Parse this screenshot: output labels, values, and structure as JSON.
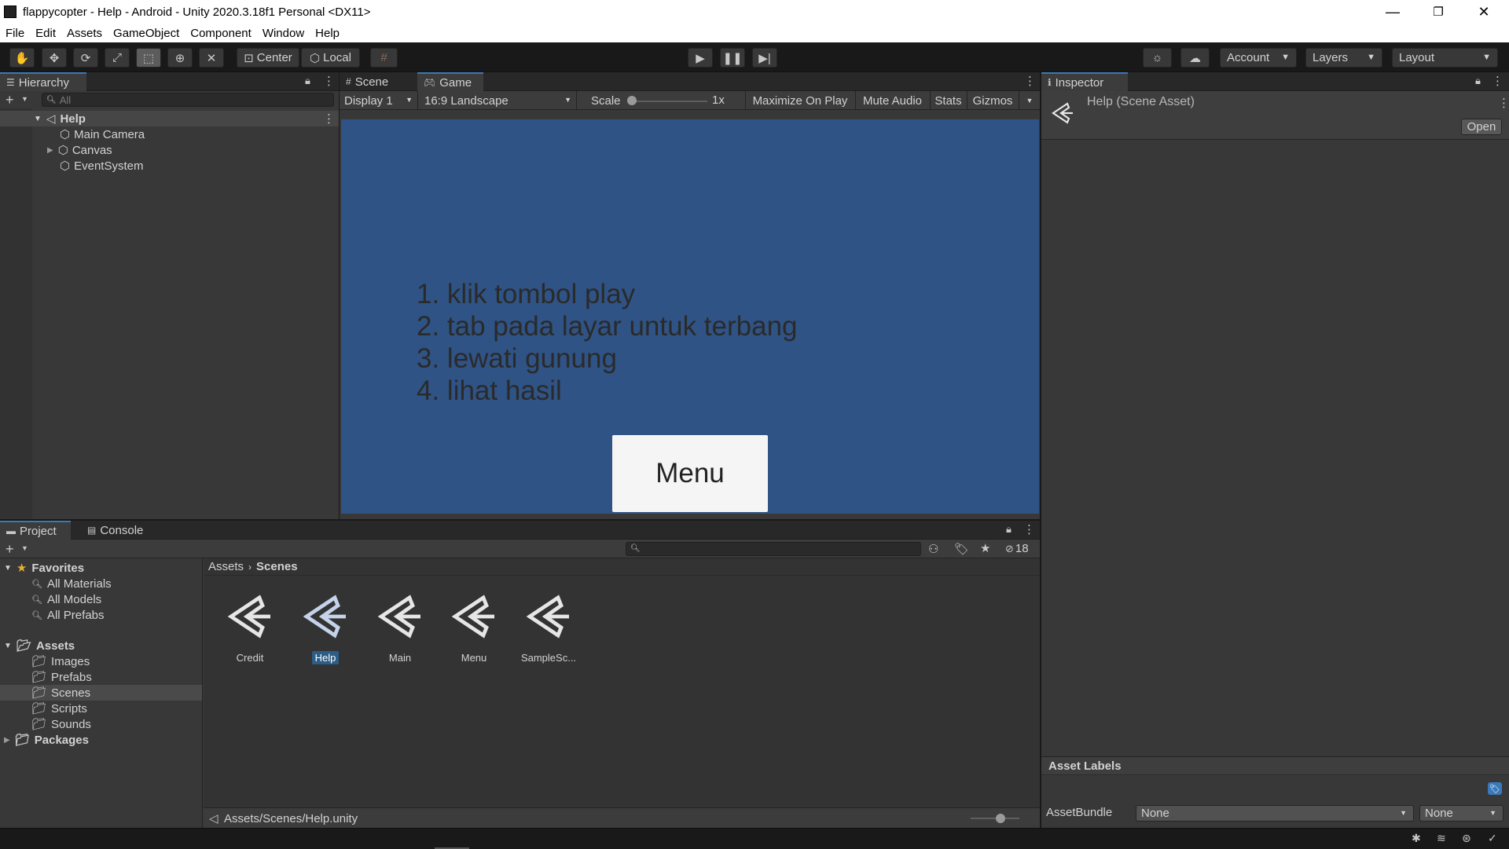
{
  "window": {
    "title": "flappycopter - Help - Android - Unity 2020.3.18f1 Personal <DX11>",
    "minimize": "—",
    "restore": "❐",
    "close": "✕"
  },
  "menu": [
    "File",
    "Edit",
    "Assets",
    "GameObject",
    "Component",
    "Window",
    "Help"
  ],
  "toolbar": {
    "pivot_label": "Center",
    "space_label": "Local",
    "account_label": "Account",
    "layers_label": "Layers",
    "layout_label": "Layout"
  },
  "hierarchy": {
    "tab_label": "Hierarchy",
    "search_placeholder": "All",
    "scene_name": "Help",
    "objects": [
      "Main Camera",
      "Canvas",
      "EventSystem"
    ]
  },
  "scene_tabs": {
    "scene_label": "Scene",
    "game_label": "Game"
  },
  "game_toolbar": {
    "display": "Display 1",
    "aspect": "16:9 Landscape",
    "scale_label": "Scale",
    "scale_value": "1x",
    "maximize": "Maximize On Play",
    "mute": "Mute Audio",
    "stats": "Stats",
    "gizmos": "Gizmos"
  },
  "game_view": {
    "lines": [
      "1. klik tombol play",
      "2. tab pada layar untuk terbang",
      "3. lewati gunung",
      "4. lihat hasil"
    ],
    "button_label": "Menu",
    "bg_color": "#2f5385"
  },
  "inspector": {
    "tab_label": "Inspector",
    "asset_title": "Help (Scene Asset)",
    "open_label": "Open",
    "asset_labels_title": "Asset Labels",
    "assetbundle_label": "AssetBundle",
    "assetbundle_value": "None",
    "variant_value": "None"
  },
  "project": {
    "tab_label": "Project",
    "console_label": "Console",
    "hidden_count": "18",
    "favorites_label": "Favorites",
    "favorites": [
      "All Materials",
      "All Models",
      "All Prefabs"
    ],
    "assets_label": "Assets",
    "folders": [
      "Images",
      "Prefabs",
      "Scenes",
      "Scripts",
      "Sounds"
    ],
    "packages_label": "Packages",
    "breadcrumb_root": "Assets",
    "breadcrumb_current": "Scenes",
    "items": [
      "Credit",
      "Help",
      "Main",
      "Menu",
      "SampleSc..."
    ],
    "selected_item": "Help",
    "footer_path": "Assets/Scenes/Help.unity"
  }
}
